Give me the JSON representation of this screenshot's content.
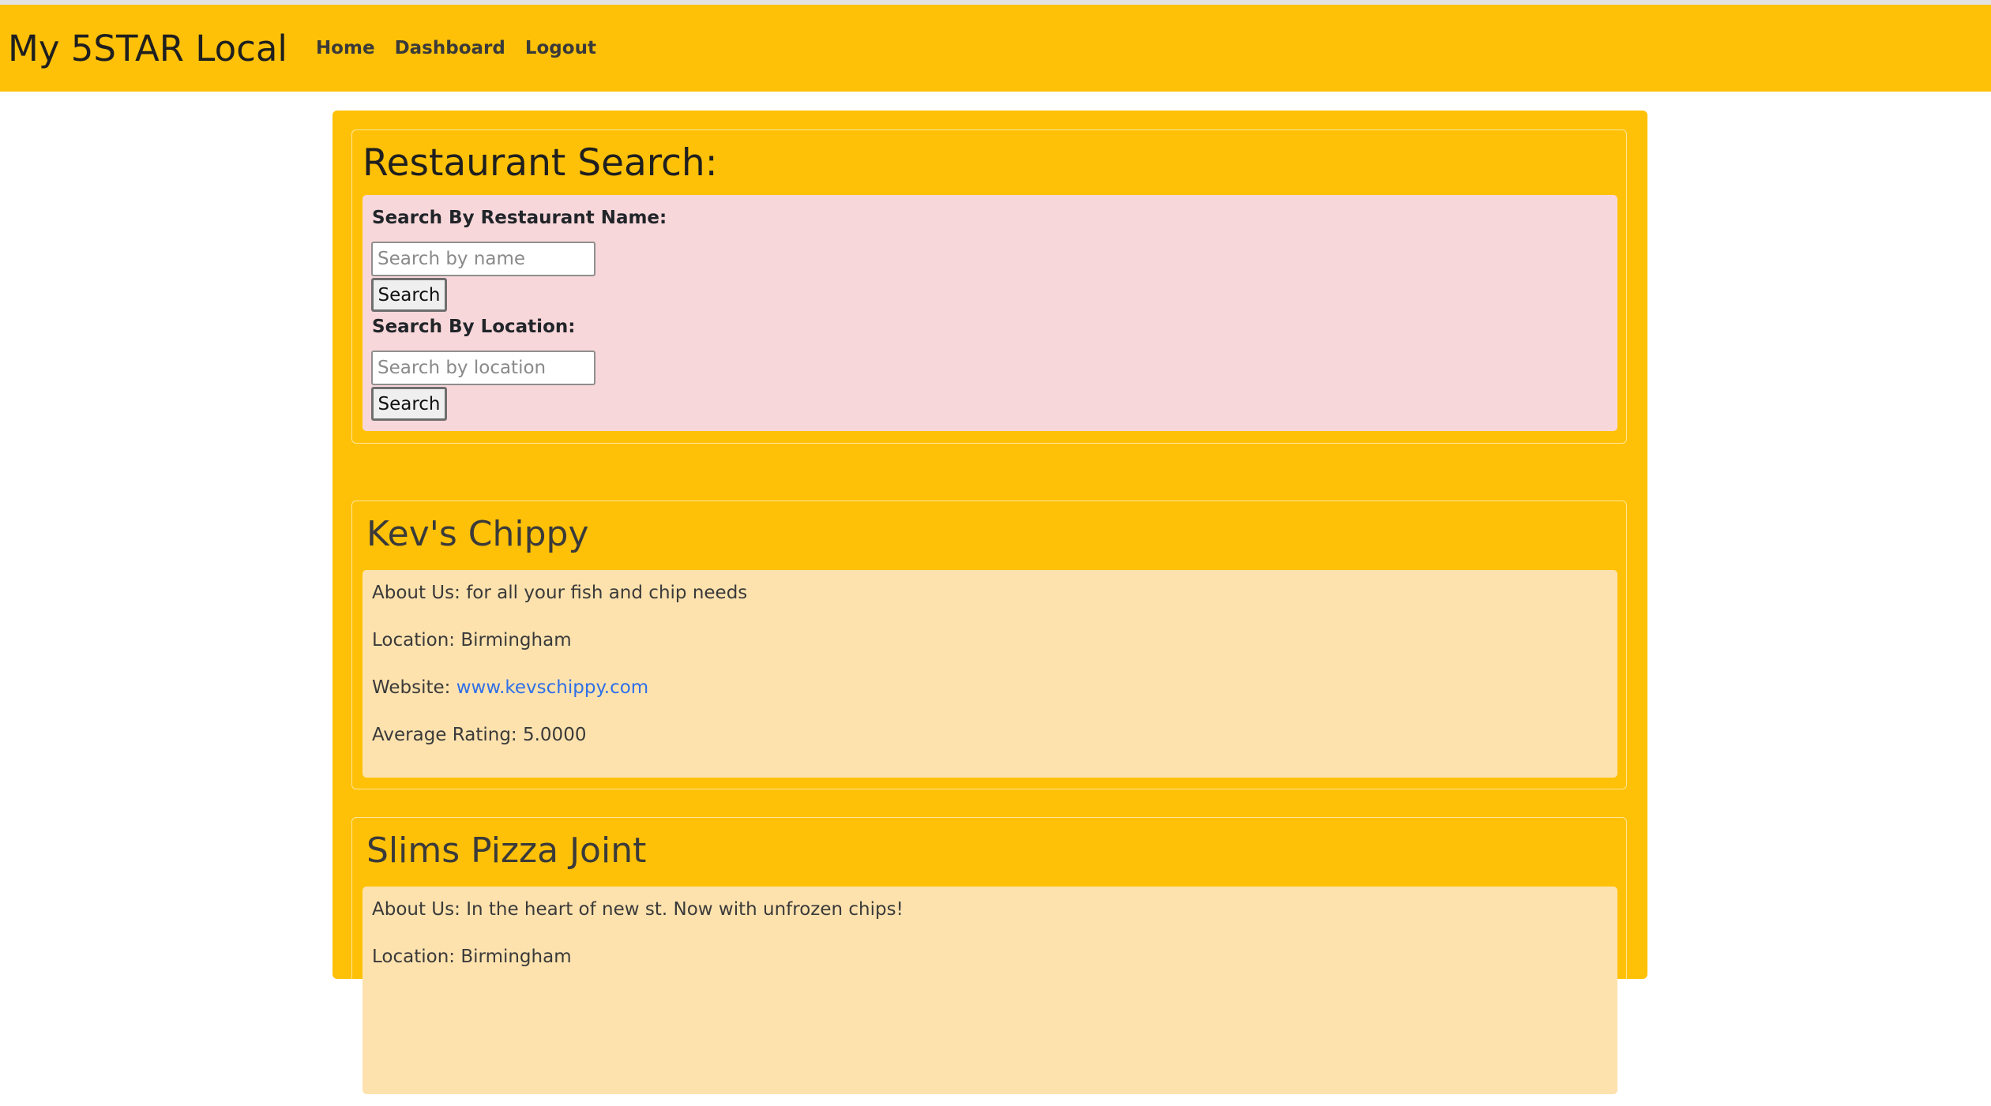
{
  "navbar": {
    "brand": "My 5STAR Local",
    "links": [
      "Home",
      "Dashboard",
      "Logout"
    ],
    "background_color": "#ffc107"
  },
  "search": {
    "title": "Restaurant Search:",
    "by_name": {
      "label": "Search By Restaurant Name:",
      "placeholder": "Search by name",
      "button": "Search"
    },
    "by_location": {
      "label": "Search By Location:",
      "placeholder": "Search by location",
      "button": "Search"
    },
    "panel_color": "#f8d7da"
  },
  "restaurants": [
    {
      "name": "Kev's Chippy",
      "about_prefix": "About Us: ",
      "about": "for all your fish and chip needs",
      "location_prefix": "Location: ",
      "location": "Birmingham",
      "website_prefix": "Website: ",
      "website": "www.kevschippy.com",
      "rating_prefix": "Average Rating: ",
      "rating": "5.0000"
    },
    {
      "name": "Slims Pizza Joint",
      "about_prefix": "About Us: ",
      "about": "In the heart of new st. Now with unfrozen chips!",
      "location_prefix": "Location: ",
      "location": "Birmingham"
    }
  ],
  "colors": {
    "accent": "#ffc107",
    "card_body": "#fde2ae",
    "link": "#2f6fe8"
  }
}
